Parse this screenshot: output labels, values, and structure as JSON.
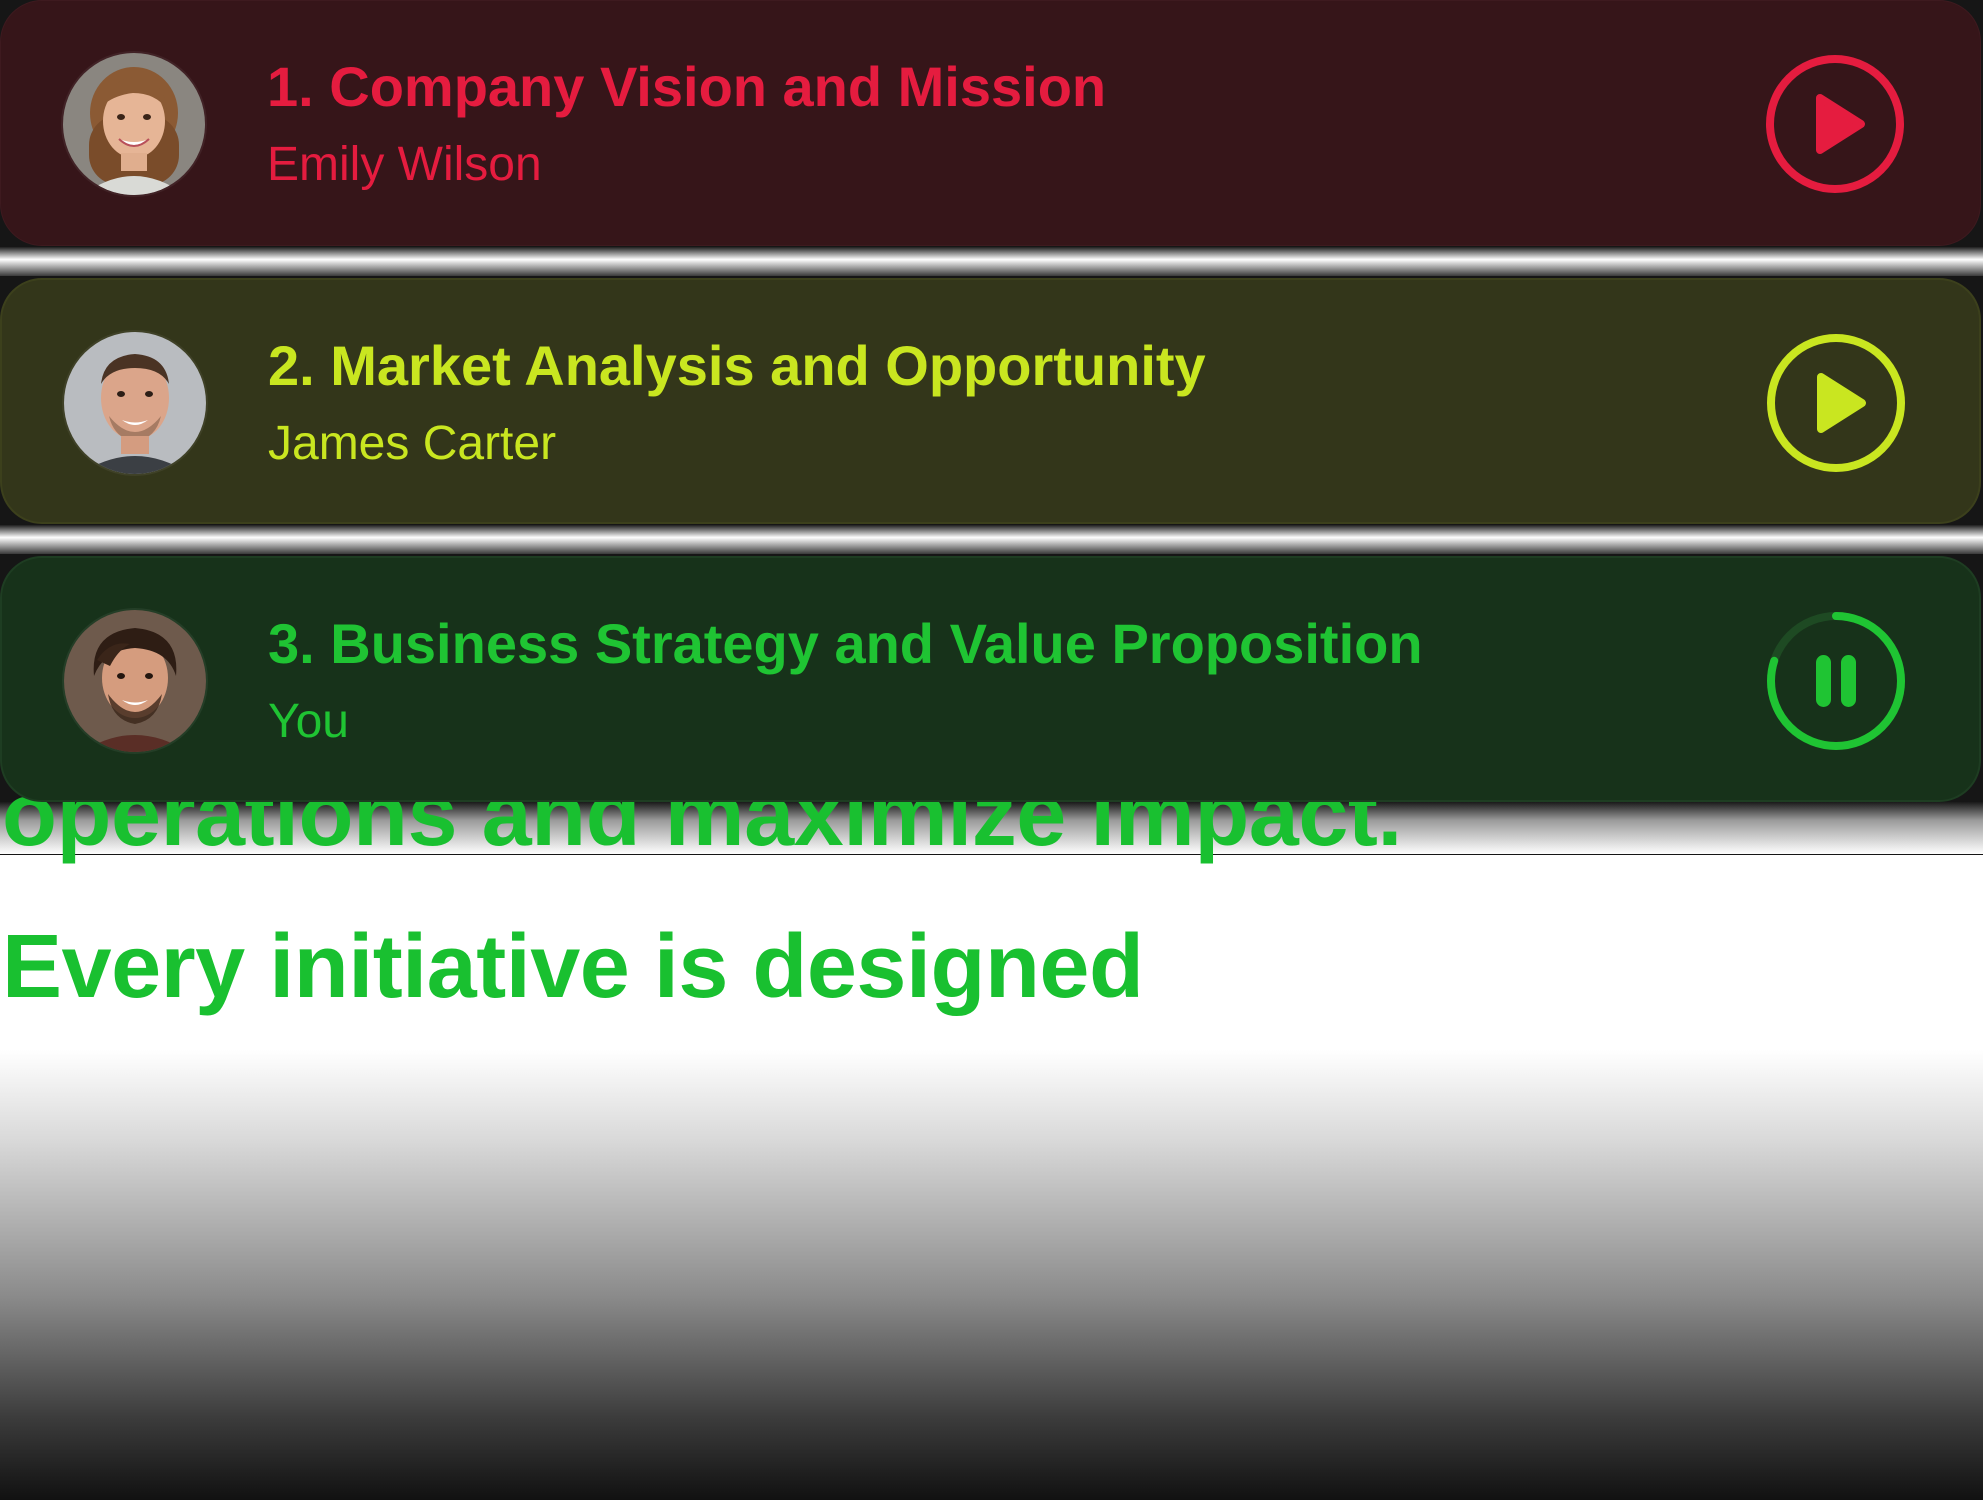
{
  "playlist": {
    "items": [
      {
        "index_title": "1. Company Vision and Mission",
        "presenter": "Emily Wilson",
        "control": "play",
        "control_icon": "play-icon",
        "accent": "#e51c3f",
        "background": "#361519",
        "avatar_icon": "avatar-emily-wilson"
      },
      {
        "index_title": "2. Market Analysis and Opportunity",
        "presenter": "James Carter",
        "control": "play",
        "control_icon": "play-icon",
        "accent": "#c9e620",
        "background": "#33361a",
        "avatar_icon": "avatar-james-carter"
      },
      {
        "index_title": "3. Business Strategy and Value Proposition",
        "presenter": "You",
        "control": "pause",
        "control_icon": "pause-icon",
        "accent": "#1fc433",
        "background": "#17321a",
        "avatar_icon": "avatar-you",
        "progress": 0.8
      }
    ]
  },
  "transcript": {
    "lines": [
      "operations and maximize impact.",
      "Every initiative is designed"
    ],
    "color": "#19c030"
  }
}
